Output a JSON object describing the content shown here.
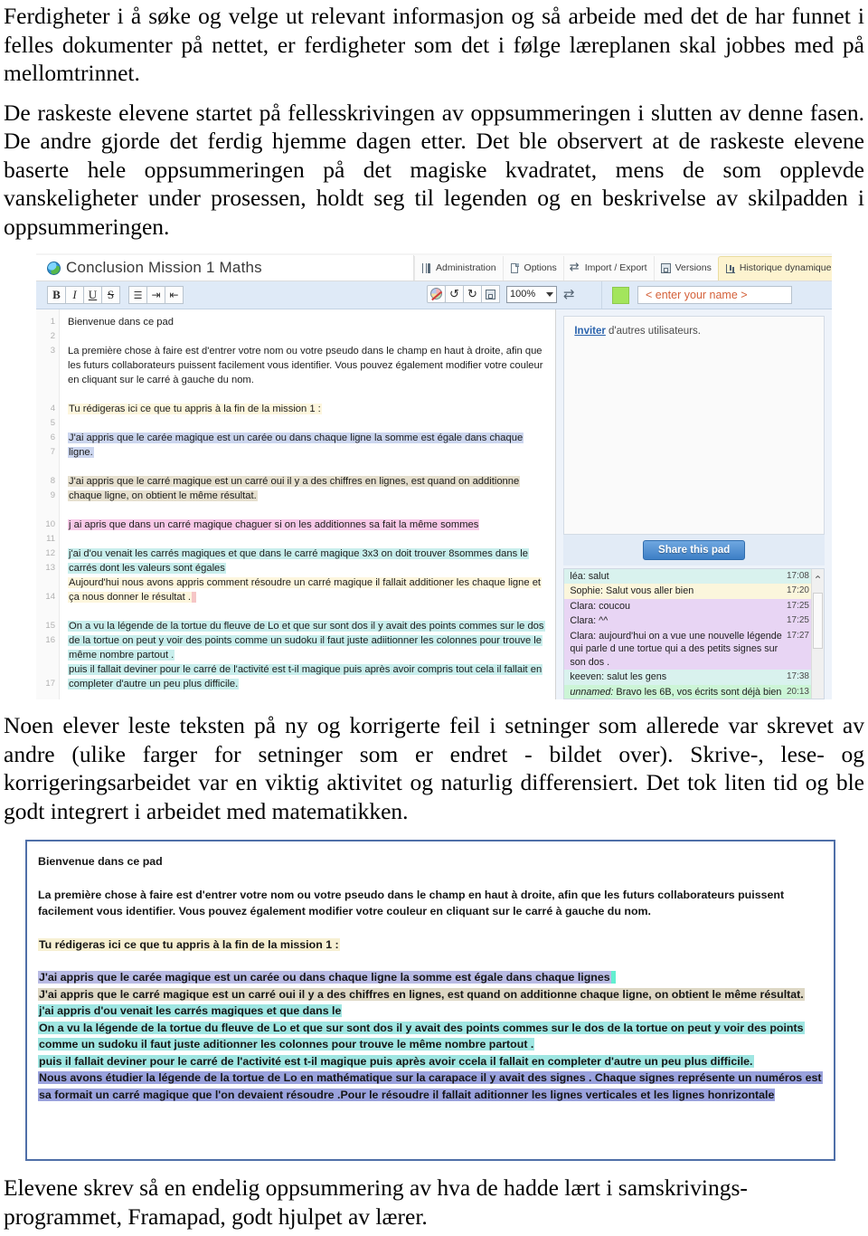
{
  "document": {
    "paragraphs": {
      "intro": "Ferdigheter i å søke og velge ut relevant informasjon og så arbeide med det de har funnet i felles dokumenter på nettet, er ferdigheter som det i følge læreplanen skal jobbes med på mellomtrinnet.",
      "fast_students": "De raskeste elevene startet på fellesskrivingen av oppsummeringen i slutten av denne fasen. De andre gjorde det ferdig hjemme dagen etter. Det ble observert at de raskeste elevene baserte hele oppsummeringen på det magiske kvadratet, mens de som opplevde vanskeligheter under prosessen, holdt seg til legenden og en beskrivelse av skilpadden i oppsummeringen.",
      "correction": "Noen elever leste teksten på ny og korrigerte feil i setninger som allerede var skrevet av andre (ulike farger for setninger som er endret - bildet over). Skrive-, lese- og korrigeringsarbeidet var en viktig aktivitet og naturlig differensiert. Det tok liten tid og ble godt integrert i arbeidet med matematikken.",
      "final": "Elevene skrev så en endelig oppsummering av hva de hadde lært i samskrivings-programmet, Framapad, godt hjulpet av lærer."
    }
  },
  "screenshot_pad": {
    "title": "Conclusion Mission 1 Maths",
    "menus": [
      {
        "label": "Administration",
        "icon": "utensils-icon",
        "active": false
      },
      {
        "label": "Options",
        "icon": "document-icon",
        "active": false
      },
      {
        "label": "Import / Export",
        "icon": "swap-arrows-icon",
        "active": false
      },
      {
        "label": "Versions",
        "icon": "floppy-save-icon",
        "active": false
      },
      {
        "label": "Historique dynamique",
        "icon": "timeline-chart-icon",
        "active": true
      }
    ],
    "toolbar": {
      "bold": "B",
      "italic": "I",
      "underline": "U",
      "strikethrough": "S",
      "unordered_list": "list-icon",
      "indent": "indent-icon",
      "outdent": "outdent-icon",
      "clear_authorship": "clear-authorship-colors-icon",
      "undo": "↺",
      "redo": "↻",
      "save_revision": "floppy-icon",
      "zoom_value": "100%",
      "import_export": "⇄"
    },
    "user": {
      "color": "#a3e55c",
      "name_placeholder": "< enter your name >"
    },
    "line_numbers": [
      "1",
      "2",
      "3",
      "4",
      "5",
      "6",
      "7",
      "8",
      "9",
      "10",
      "11",
      "12",
      "13",
      "14",
      "15",
      "16",
      "17"
    ],
    "lines": [
      {
        "n": "1",
        "text": "Bienvenue dans ce pad",
        "highlight": "none"
      },
      {
        "n": "3",
        "text": "La première chose à faire est d'entrer votre nom ou votre pseudo dans le champ en haut à droite, afin que les futurs collaborateurs puissent facilement vous identifier. Vous pouvez également modifier votre couleur en cliquant sur le carré à gauche du nom.",
        "highlight": "none"
      },
      {
        "n": "5",
        "text": "Tu rédigeras ici ce que tu appris à la fin de la mission 1 :",
        "highlight": "yellow"
      },
      {
        "n": "7",
        "text": "J'ai appris que le carée magique est un carée ou dans chaque ligne la somme est égale dans chaque ligne.",
        "highlight": "blue"
      },
      {
        "n": "9",
        "text": "J'ai appris que le carré magique est un carré oui il y a des chiffres en lignes, est quand on additionne chaque ligne, on obtient le même résultat.",
        "highlight": "tan"
      },
      {
        "n": "11",
        "text": "j ai apris que dans un carré magique chaguer si on les additionnes sa fait la même sommes",
        "highlight": "pink"
      },
      {
        "n": "13",
        "text": "j'ai d'ou venait les carrés magiques et que dans le carré magique 3x3 on doit trouver 8sommes dans le carrés dont les valeurs sont égales",
        "highlight": "cyan"
      },
      {
        "n": "14",
        "text": "Aujourd'hui nous avons appris comment résoudre un carré magique il fallait additioner les chaque ligne et ça nous donner le résultat .",
        "highlight": "yellow"
      },
      {
        "n": "16",
        "text": "On a vu la légende de la tortue du fleuve de Lo et que sur sont dos il y avait des points commes sur le dos de la tortue on peut y voir des points comme un sudoku il faut juste adiitionner les colonnes pour trouve le même nombre partout .",
        "highlight": "cyan"
      },
      {
        "n": "17",
        "text": "puis il fallait deviner pour le carré de l'activité est t-il magique puis après avoir compris tout cela il fallait en completer d'autre un peu plus difficile.",
        "highlight": "cyan"
      }
    ],
    "sidebar": {
      "invite_link": "Inviter",
      "invite_text": " d'autres utilisateurs.",
      "share_button": "Share this pad",
      "scroll_up_icon": "chevron-up-icon"
    },
    "chat": [
      {
        "name": "léa:",
        "text": " salut",
        "time": "17:08",
        "color": "#d9f2ee",
        "italic": false
      },
      {
        "name": "Sophie:",
        "text": " Salut vous aller bien",
        "time": "17:20",
        "color": "#fbf6dc",
        "italic": false
      },
      {
        "name": "Clara:",
        "text": " coucou",
        "time": "17:25",
        "color": "#e8d5f4",
        "italic": false
      },
      {
        "name": "Clara:",
        "text": " ^^",
        "time": "17:25",
        "color": "#e8d5f4",
        "italic": false
      },
      {
        "name": "Clara:",
        "text": " aujourd'hui on a vue une nouvelle légende qui parle d une tortue qui a des petits signes sur son dos .",
        "time": "17:27",
        "color": "#e8d5f4",
        "italic": false
      },
      {
        "name": "keeven:",
        "text": " salut les gens",
        "time": "17:38",
        "color": "#d9f2ee",
        "italic": false
      },
      {
        "name": "unnamed:",
        "text": " Bravo les 6B, vos écrits sont déjà bien",
        "time": "20:13",
        "color": "#ccf5d6",
        "italic": true
      }
    ]
  },
  "screenshot_final": {
    "border_color": "#4f6fa8",
    "lines": [
      {
        "text": "Bienvenue dans ce pad",
        "highlight": "none"
      },
      {
        "text": "La première chose à faire est d'entrer votre nom ou votre pseudo dans le champ en haut à droite, afin que les futurs collaborateurs puissent facilement vous identifier. Vous pouvez également modifier votre couleur en cliquant sur le carré à gauche du nom.",
        "highlight": "none"
      },
      {
        "text": "Tu rédigeras ici ce que tu appris à la fin de la mission 1 :",
        "highlight": "yellow"
      },
      {
        "text": "J'ai appris que le carée magique est un carée ou dans chaque ligne la somme est égale dans chaque lignes",
        "highlight": "violet"
      },
      {
        "text": "J'ai appris que le carré magique est un carré oui il y a des chiffres en lignes, est quand on additionne chaque ligne, on obtient le même résultat.",
        "highlight": "tan"
      },
      {
        "text": "j'ai appris d'ou venait les carrés magiques et que dans le",
        "highlight": "cyan"
      },
      {
        "text": "On a vu la légende de la tortue du fleuve de Lo et que sur sont dos il y avait des points commes sur le dos de la tortue on peut y voir des points comme un sudoku il faut juste aditionner les colonnes pour trouve le même nombre partout .",
        "highlight": "cyan"
      },
      {
        "text": "puis il fallait deviner pour le carré de l'activité est t-il magique puis après avoir ccela il fallait en completer d'autre un peu plus difficile.",
        "highlight": "cyan"
      },
      {
        "text": "Nous avons étudier la légende de la tortue de Lo en mathématique sur la carapace il y avait des signes . Chaque signes représente un numéros est sa formait un carré magique que l'on devaient résoudre .Pour le résoudre il fallait aditionner les lignes verticales et les lignes honrizontale",
        "highlight": "blue"
      }
    ]
  }
}
